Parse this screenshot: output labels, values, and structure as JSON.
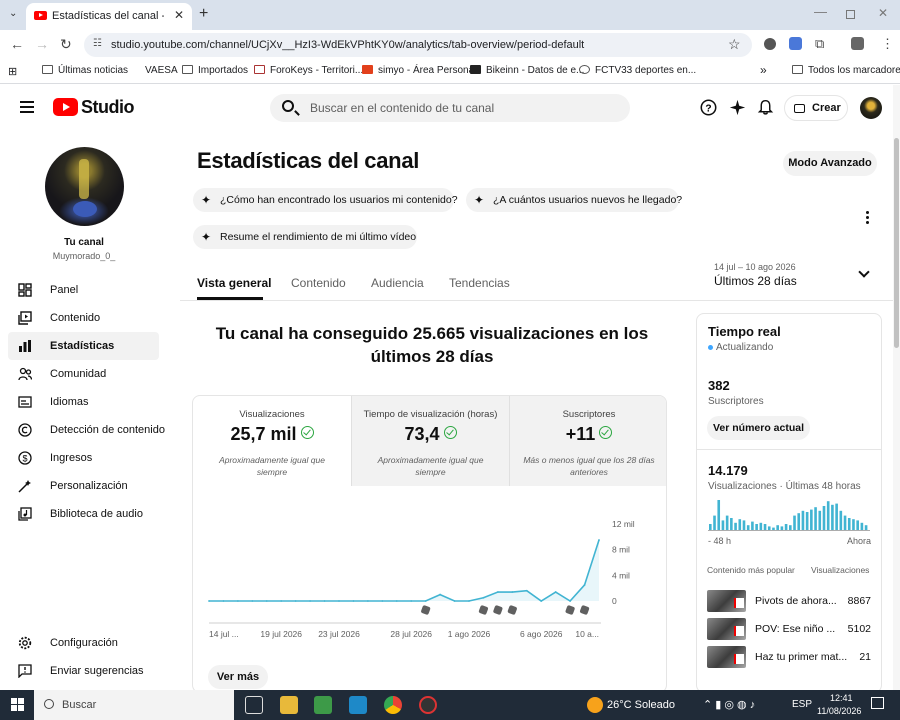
{
  "browser": {
    "tab_title": "Estadísticas del canal - YouTube",
    "url": "studio.youtube.com/channel/UCjXv__HzI3-WdEkVPhtKY0w/analytics/tab-overview/period-default",
    "bookmarks": [
      "Últimas noticias",
      "VAESA",
      "Importados",
      "ForoKeys - Territori...",
      "simyo - Área Personal",
      "Bikeinn - Datos de e...",
      "FCTV33 deportes en..."
    ],
    "all_bookmarks": "Todos los marcadores",
    "more_bookmarks": "»"
  },
  "studio_header": {
    "logo_text": "Studio",
    "search_placeholder": "Buscar en el contenido de tu canal",
    "create_label": "Crear"
  },
  "sidebar": {
    "channel_label": "Tu canal",
    "channel_handle": "Muymorado_0_",
    "items": [
      {
        "label": "Panel",
        "icon": "dashboard-icon",
        "active": false
      },
      {
        "label": "Contenido",
        "icon": "content-icon",
        "active": false
      },
      {
        "label": "Estadísticas",
        "icon": "analytics-icon",
        "active": true
      },
      {
        "label": "Comunidad",
        "icon": "community-icon",
        "active": false
      },
      {
        "label": "Idiomas",
        "icon": "subtitles-icon",
        "active": false
      },
      {
        "label": "Detección de contenido",
        "icon": "copyright-icon",
        "active": false
      },
      {
        "label": "Ingresos",
        "icon": "earn-icon",
        "active": false
      },
      {
        "label": "Personalización",
        "icon": "customization-icon",
        "active": false
      },
      {
        "label": "Biblioteca de audio",
        "icon": "audio-library-icon",
        "active": false
      }
    ],
    "settings_label": "Configuración",
    "feedback_label": "Enviar sugerencias"
  },
  "main": {
    "title": "Estadísticas del canal",
    "advanced_mode": "Modo Avanzado",
    "chips": [
      "¿Cómo han encontrado los usuarios mi contenido?",
      "¿A cuántos usuarios nuevos he llegado?",
      "Resume el rendimiento de mi último vídeo"
    ],
    "tabs": [
      "Vista general",
      "Contenido",
      "Audiencia",
      "Tendencias"
    ],
    "date_range_small": "14 jul – 10 ago 2026",
    "date_range": "Últimos 28 días",
    "headline": "Tu canal ha conseguido 25.665 visualizaciones en los últimos 28 días",
    "metrics": [
      {
        "label": "Visualizaciones",
        "value": "25,7 mil",
        "note": "Aproximadamente igual que siempre"
      },
      {
        "label": "Tiempo de visualización (horas)",
        "value": "73,4",
        "note": "Aproximadamente igual que siempre"
      },
      {
        "label": "Suscriptores",
        "value": "+11",
        "note": "Más o menos igual que los 28 días anteriores"
      }
    ],
    "see_more": "Ver más"
  },
  "chart_data": {
    "type": "line",
    "x": [
      "14 jul",
      "15 jul",
      "16 jul",
      "17 jul",
      "18 jul",
      "19 jul",
      "20 jul",
      "21 jul",
      "22 jul",
      "23 jul",
      "24 jul",
      "25 jul",
      "26 jul",
      "27 jul",
      "28 jul",
      "29 jul",
      "30 jul",
      "31 jul",
      "1 ago",
      "2 ago",
      "3 ago",
      "4 ago",
      "5 ago",
      "6 ago",
      "7 ago",
      "8 ago",
      "9 ago",
      "10 ago"
    ],
    "values": [
      0,
      0,
      0,
      0,
      0,
      0,
      0,
      0,
      0,
      0,
      0,
      0,
      0,
      0,
      0,
      0,
      1.0,
      0,
      0,
      0.5,
      1.4,
      1.4,
      1.6,
      0,
      1.4,
      0,
      2.5,
      9.5
    ],
    "x_tick_labels": [
      "14 jul ...",
      "19 jul 2026",
      "23 jul 2026",
      "28 jul 2026",
      "1 ago 2026",
      "6 ago 2026",
      "10 a..."
    ],
    "y_tick_labels": [
      "12 mil",
      "8 mil",
      "4 mil",
      "0"
    ],
    "ylim": [
      0,
      12
    ],
    "ylabel_unit": "mil",
    "line_color": "#41b4d2",
    "video_markers": [
      "29 jul",
      "2 ago",
      "3 ago",
      "4 ago",
      "8 ago",
      "9 ago"
    ]
  },
  "realtime": {
    "title": "Tiempo real",
    "status": "Actualizando",
    "subscribers_value": "382",
    "subscribers_label": "Suscriptores",
    "see_count_button": "Ver número actual",
    "views_value": "14.179",
    "views_label": "Visualizaciones · Últimas 48 horas",
    "axis_left": "- 48 h",
    "axis_right": "Ahora",
    "bar_values": [
      5,
      12,
      25,
      8,
      12,
      10,
      6,
      9,
      8,
      4,
      7,
      5,
      6,
      5,
      3,
      2,
      4,
      3,
      5,
      4,
      12,
      14,
      16,
      15,
      17,
      19,
      16,
      20,
      24,
      21,
      22,
      16,
      12,
      10,
      9,
      8,
      6,
      4
    ],
    "popular_header": "Contenido más popular",
    "popular_views_header": "Visualizaciones",
    "videos": [
      {
        "title": "Pivots de ahora...",
        "views": "8867"
      },
      {
        "title": "POV: Ese niño ...",
        "views": "5102"
      },
      {
        "title": "Haz tu primer mat...",
        "views": "21"
      }
    ]
  },
  "taskbar": {
    "search_label": "Buscar",
    "weather": "26°C  Soleado",
    "lang": "ESP",
    "time": "12:41",
    "date": "11/08/2026"
  }
}
